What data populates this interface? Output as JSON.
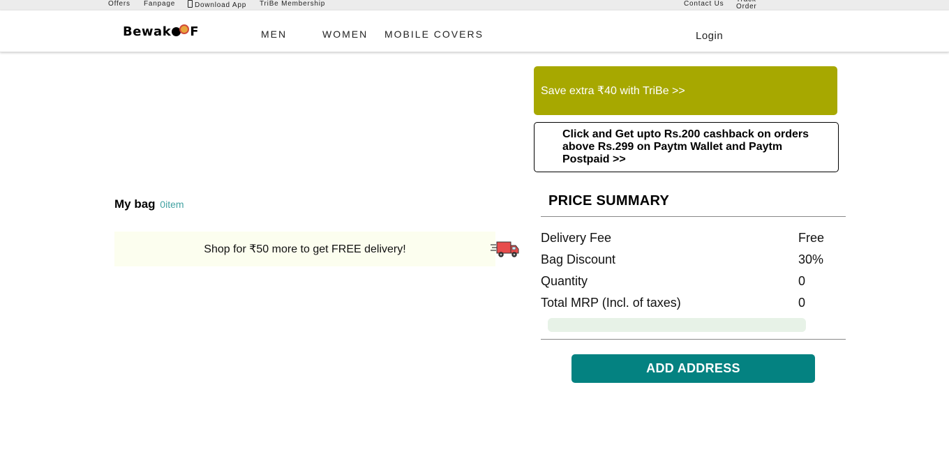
{
  "top_strip": {
    "offers": "Offers",
    "fanpage": "Fanpage",
    "download_app": "Download App",
    "tribe_membership": "TriBe Membership",
    "contact_us": "Contact Us",
    "track_order": "Track Order"
  },
  "header": {
    "logo": "Bewakoof",
    "nav": [
      "MEN",
      "WOMEN",
      "MOBILE COVERS"
    ],
    "login": "Login"
  },
  "bag": {
    "title": "My bag",
    "count": "0item",
    "delivery_message": "Shop for ₹50 more to get FREE delivery!"
  },
  "offers": {
    "tribe_banner": "Save extra ₹40 with TriBe >>",
    "paytm_offer": "Click and Get upto Rs.200 cashback on orders above Rs.299 on Paytm Wallet and Paytm Postpaid >>"
  },
  "price_summary": {
    "title": "PRICE SUMMARY",
    "rows": [
      {
        "label": "Delivery Fee",
        "value": "Free"
      },
      {
        "label": "Bag Discount",
        "value": "30%"
      },
      {
        "label": "Quantity",
        "value": "0"
      },
      {
        "label": "Total MRP (Incl. of taxes)",
        "value": "0"
      }
    ],
    "progress_fraction": 0,
    "add_address_label": "ADD ADDRESS"
  },
  "colors": {
    "tribe_banner": "#a7a800",
    "add_address": "#048281",
    "count_link": "#42a2a2",
    "delivery_box": "#fcfeef"
  },
  "icons": {
    "truck": "delivery-truck-icon",
    "phone": "phone-icon"
  }
}
